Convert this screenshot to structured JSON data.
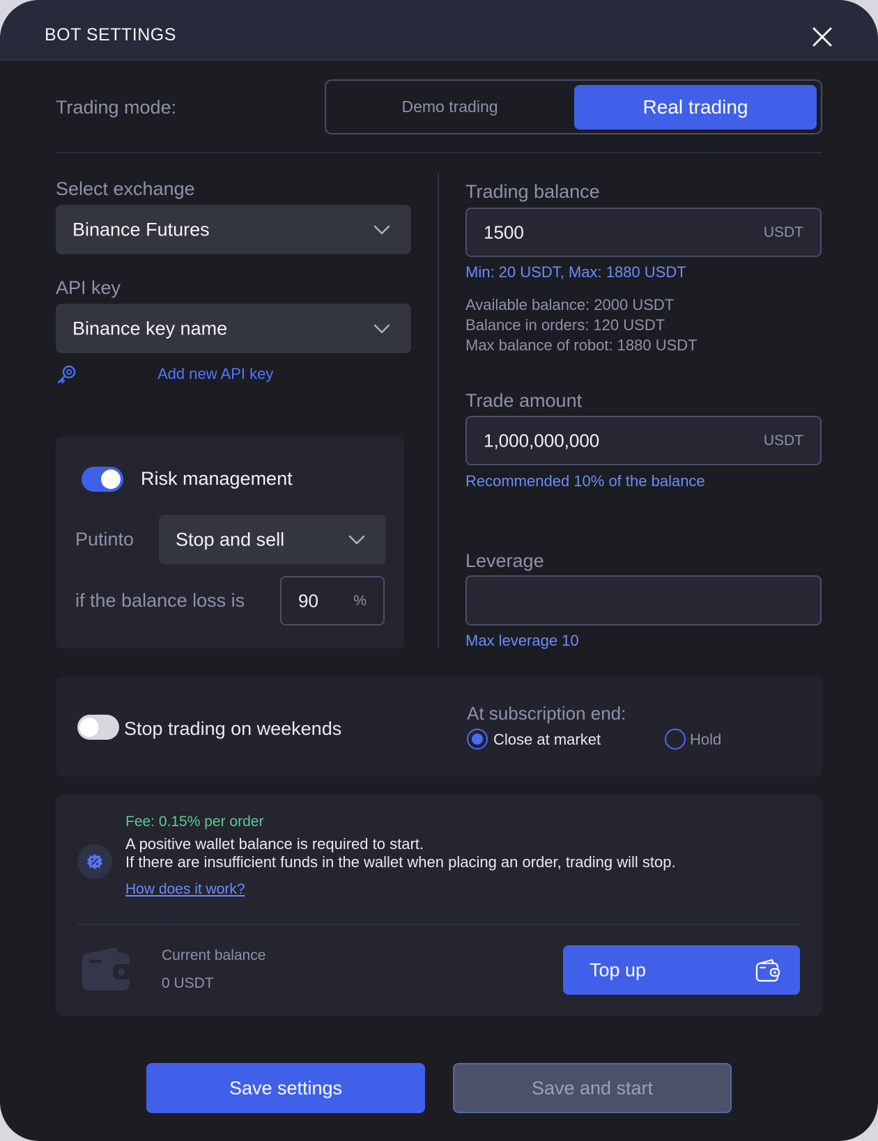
{
  "header": {
    "title": "BOT SETTINGS"
  },
  "trading_mode": {
    "label": "Trading mode:",
    "options": [
      "Demo trading",
      "Real trading"
    ],
    "selected": "Real trading"
  },
  "exchange": {
    "label": "Select exchange",
    "value": "Binance Futures"
  },
  "api_key": {
    "label": "API key",
    "value": "Binance key name",
    "add_link": "Add new API key"
  },
  "risk": {
    "enabled": true,
    "label": "Risk management",
    "put_into_label": "Putinto",
    "put_into_value": "Stop and sell",
    "loss_label": "if the balance loss is",
    "loss_value": "90",
    "loss_unit": "%"
  },
  "trading_balance": {
    "label": "Trading balance",
    "value": "1500",
    "unit": "USDT",
    "hint": "Min: 20 USDT, Max: 1880 USDT",
    "info": [
      "Available balance: 2000 USDT",
      "Balance in orders: 120 USDT",
      "Max balance of robot: 1880 USDT"
    ]
  },
  "trade_amount": {
    "label": "Trade amount",
    "value": "1,000,000,000",
    "unit": "USDT",
    "hint": "Recommended 10% of the balance"
  },
  "leverage": {
    "label": "Leverage",
    "value": "",
    "hint": "Max leverage 10"
  },
  "weekends": {
    "enabled": false,
    "label": "Stop trading on weekends"
  },
  "subscription_end": {
    "label": "At subscription end:",
    "options": [
      "Close at market",
      "Hold"
    ],
    "selected": "Close at market"
  },
  "fee": {
    "fee_line": "Fee: 0.15% per order",
    "line1": "A positive wallet balance is required to start.",
    "line2": "If there are insufficient funds in the wallet when placing an order, trading will stop.",
    "link": "How does it work?"
  },
  "wallet": {
    "current_label": "Current balance",
    "current_value": "0 USDT",
    "topup_label": "Top up"
  },
  "actions": {
    "save": "Save settings",
    "save_start": "Save and start"
  },
  "colors": {
    "accent": "#4060ea",
    "link": "#6a8bff",
    "fee_green": "#5ecb8f",
    "background": "#1c1d22"
  }
}
